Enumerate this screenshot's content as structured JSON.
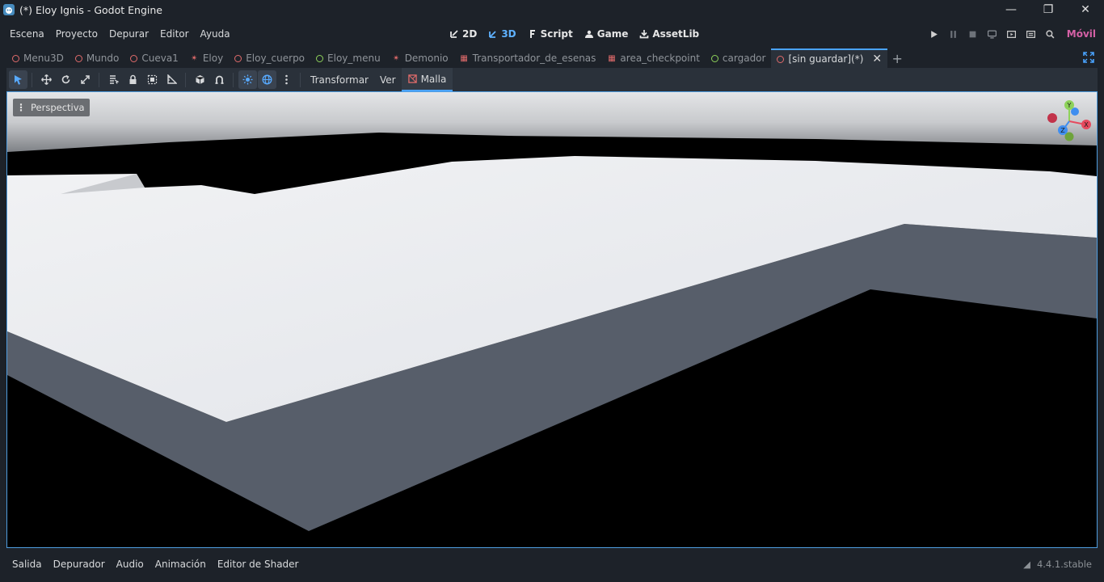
{
  "window": {
    "title": "(*) Eloy Ignis - Godot Engine"
  },
  "menu": [
    "Escena",
    "Proyecto",
    "Depurar",
    "Editor",
    "Ayuda"
  ],
  "main_screens": [
    {
      "label": "2D",
      "icon": "2d-icon"
    },
    {
      "label": "3D",
      "icon": "3d-icon",
      "active": true
    },
    {
      "label": "Script",
      "icon": "script-icon"
    },
    {
      "label": "Game",
      "icon": "game-icon"
    },
    {
      "label": "AssetLib",
      "icon": "assetlib-icon"
    }
  ],
  "run_bar": {
    "renderer": "Móvil"
  },
  "scene_tabs": [
    {
      "label": "Menu3D",
      "icon": "node3d-icon"
    },
    {
      "label": "Mundo",
      "icon": "node3d-icon"
    },
    {
      "label": "Cueva1",
      "icon": "node3d-icon"
    },
    {
      "label": "Eloy",
      "icon": "character-icon"
    },
    {
      "label": "Eloy_cuerpo",
      "icon": "node3d-icon"
    },
    {
      "label": "Eloy_menu",
      "icon": "control-icon"
    },
    {
      "label": "Demonio",
      "icon": "character-icon"
    },
    {
      "label": "Transportador_de_esenas",
      "icon": "area-icon"
    },
    {
      "label": "area_checkpoint",
      "icon": "area-icon"
    },
    {
      "label": "cargador",
      "icon": "control-icon"
    },
    {
      "label": "[sin guardar](*)",
      "icon": "node3d-icon",
      "active": true
    }
  ],
  "toolbar": {
    "transform_menu": "Transformar",
    "view_menu": "Ver",
    "mesh_menu": "Malla"
  },
  "viewport": {
    "perspective_label": "Perspectiva",
    "gizmo_axes": {
      "x": "X",
      "y": "Y",
      "z": "Z"
    },
    "colors": {
      "floor_top": "#e6e8ec",
      "floor_side": "#575e6a",
      "sky": "#cfd1d4",
      "void": "#000000"
    }
  },
  "bottom_panel": {
    "tabs": [
      "Salida",
      "Depurador",
      "Audio",
      "Animación",
      "Editor de Shader"
    ],
    "version": "4.4.1.stable"
  }
}
